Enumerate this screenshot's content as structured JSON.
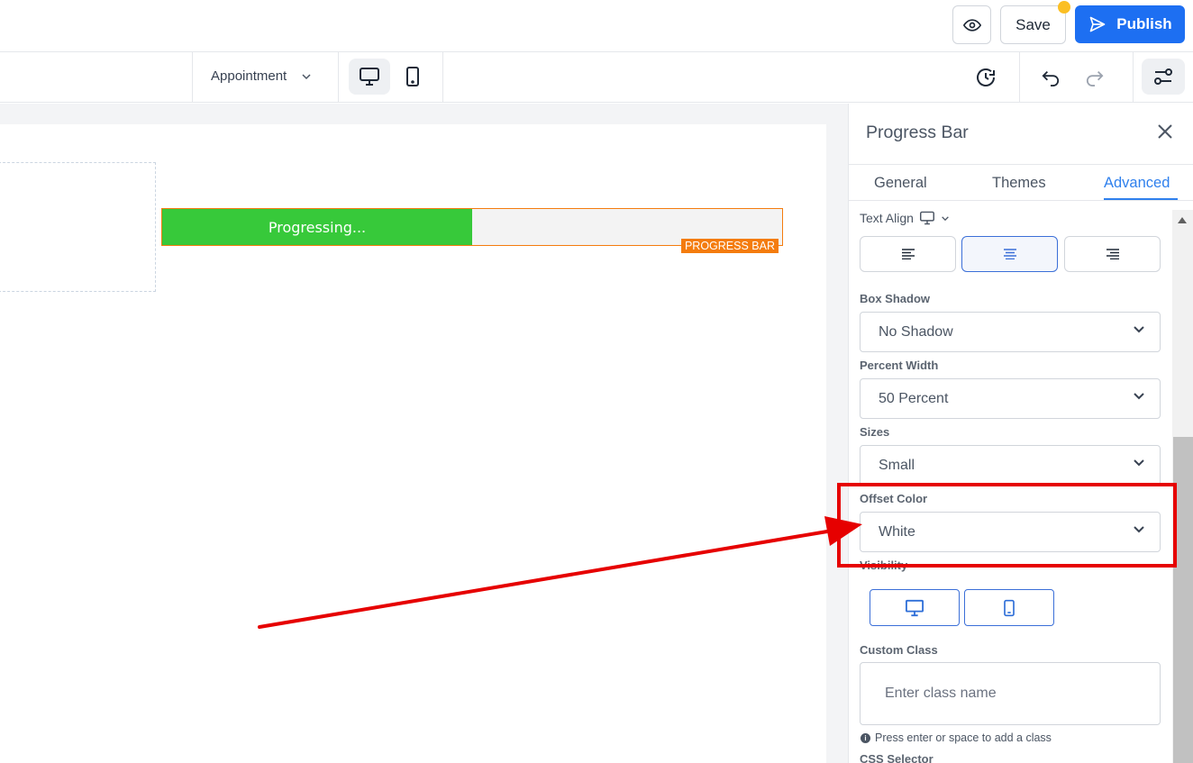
{
  "header": {
    "save_label": "Save",
    "publish_label": "Publish"
  },
  "toolbar": {
    "page_select_label": "Appointment"
  },
  "canvas": {
    "progress_bar_text": "Progressing...",
    "progress_percent": 50,
    "element_tag": "PROGRESS BAR"
  },
  "panel": {
    "title": "Progress Bar",
    "tabs": [
      {
        "label": "General",
        "active": false
      },
      {
        "label": "Themes",
        "active": false
      },
      {
        "label": "Advanced",
        "active": true
      }
    ],
    "text_align_label": "Text Align",
    "box_shadow": {
      "label": "Box Shadow",
      "value": "No Shadow"
    },
    "percent_width": {
      "label": "Percent Width",
      "value": "50 Percent"
    },
    "sizes": {
      "label": "Sizes",
      "value": "Small"
    },
    "offset_color": {
      "label": "Offset Color",
      "value": "White"
    },
    "visibility_label": "Visibility",
    "custom_class": {
      "label": "Custom Class",
      "placeholder": "Enter class name"
    },
    "hint_text": "Press enter or space to add a class",
    "css_selector_label": "CSS Selector"
  },
  "colors": {
    "primary": "#1d6ff2",
    "progress_fill": "#37c93a",
    "element_outline": "#f47c0e",
    "annotation": "#e60000"
  }
}
